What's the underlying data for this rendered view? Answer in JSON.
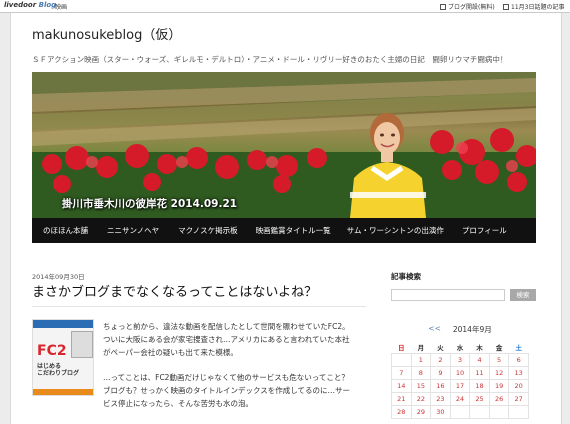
{
  "topbar": {
    "logo_main": "livedoor",
    "logo_blog": "Blog",
    "category": "映画",
    "link1": "ブログ開設(無料)",
    "link2": "11月3日話題の記事"
  },
  "site": {
    "title": "makunosukeblog（仮）",
    "description": "ＳＦアクション映画（スター・ウォーズ、ギレルモ・デルトロ）・アニメ・ドール・リヴリー好きのおたく主婦の日記　闘卵リウマチ闘病中！"
  },
  "hero": {
    "caption": "掛川市垂木川の彼岸花  2014.09.21"
  },
  "nav": {
    "items": [
      "のほほん本舗",
      "ニニサンノヘヤ",
      "マクノスケ掲示板",
      "映画鑑賞タイトル一覧",
      "サム・ワーシントンの出演作",
      "プロフィール"
    ]
  },
  "post": {
    "date": "2014年09月30日",
    "title": "まさかブログまでなくなるってことはないよね？",
    "book": {
      "fc2": "FC2",
      "subtitle_1": "はじめる",
      "subtitle_2": "こだわりブログ"
    },
    "paragraphs": [
      "ちょっと前から、違法な動画を配信したとして世間を賑わせていたFC2。",
      "ついに大阪にある会が家宅捜査され…アメリカにあると言われていた本社",
      "がペーパー会社の疑いも出て来た模様。",
      "…ってことは、FC2動画だけじゃなくて他のサービスも危ないってこと？",
      "ブログも？せっかく映画のタイトルインデックスを作成してるのに…サー",
      "ビス停止になったら、そんな苦労も水の泡。"
    ]
  },
  "sidebar": {
    "search_title": "記事検索",
    "search_button": "検索",
    "calendar": {
      "prev": "<<",
      "month": "2014年9月",
      "weekdays": [
        "日",
        "月",
        "火",
        "水",
        "木",
        "金",
        "土"
      ],
      "rows": [
        [
          "",
          "1",
          "2",
          "3",
          "4",
          "5",
          "6"
        ],
        [
          "7",
          "8",
          "9",
          "10",
          "11",
          "12",
          "13"
        ],
        [
          "14",
          "15",
          "16",
          "17",
          "18",
          "19",
          "20"
        ],
        [
          "21",
          "22",
          "23",
          "24",
          "25",
          "26",
          "27"
        ],
        [
          "28",
          "29",
          "30",
          "",
          "",
          "",
          ""
        ]
      ]
    }
  },
  "colors": {
    "nav_background": "#111111",
    "calendar_day": "#cc3333",
    "sunday": "#dd2222",
    "saturday": "#2277cc"
  }
}
